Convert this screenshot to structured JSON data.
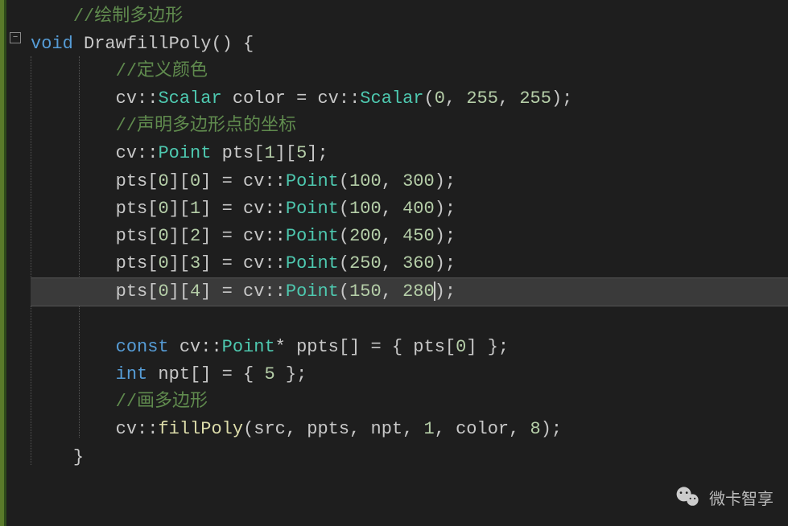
{
  "code": {
    "comment_draw": "//绘制多边形",
    "kw_void": "void",
    "func_name": " DrawfillPoly",
    "paren_open": "() {",
    "comment_color": "//定义颜色",
    "l4_p1": "cv::",
    "l4_type1": "Scalar",
    "l4_p2": " color = cv::",
    "l4_type2": "Scalar",
    "l4_p3": "(",
    "l4_n1": "0",
    "l4_p4": ", ",
    "l4_n2": "255",
    "l4_p5": ", ",
    "l4_n3": "255",
    "l4_p6": ");",
    "comment_pts": "//声明多边形点的坐标",
    "l6_p1": "cv::",
    "l6_type": "Point",
    "l6_p2": " pts[",
    "l6_n1": "1",
    "l6_p3": "][",
    "l6_n2": "5",
    "l6_p4": "];",
    "pt0_p1": "pts[",
    "pt0_n1": "0",
    "pt0_p2": "][",
    "pt0_n2": "0",
    "pt0_p3": "] = cv::",
    "pt0_type": "Point",
    "pt0_p4": "(",
    "pt0_x": "100",
    "pt0_c": ", ",
    "pt0_y": "300",
    "pt0_p5": ");",
    "pt1_p1": "pts[",
    "pt1_n1": "0",
    "pt1_p2": "][",
    "pt1_n2": "1",
    "pt1_p3": "] = cv::",
    "pt1_type": "Point",
    "pt1_p4": "(",
    "pt1_x": "100",
    "pt1_c": ", ",
    "pt1_y": "400",
    "pt1_p5": ");",
    "pt2_p1": "pts[",
    "pt2_n1": "0",
    "pt2_p2": "][",
    "pt2_n2": "2",
    "pt2_p3": "] = cv::",
    "pt2_type": "Point",
    "pt2_p4": "(",
    "pt2_x": "200",
    "pt2_c": ", ",
    "pt2_y": "450",
    "pt2_p5": ");",
    "pt3_p1": "pts[",
    "pt3_n1": "0",
    "pt3_p2": "][",
    "pt3_n2": "3",
    "pt3_p3": "] = cv::",
    "pt3_type": "Point",
    "pt3_p4": "(",
    "pt3_x": "250",
    "pt3_c": ", ",
    "pt3_y": "360",
    "pt3_p5": ");",
    "pt4_p1": "pts[",
    "pt4_n1": "0",
    "pt4_p2": "][",
    "pt4_n2": "4",
    "pt4_p3": "] = cv::",
    "pt4_type": "Point",
    "pt4_p4": "(",
    "pt4_x": "150",
    "pt4_c": ", ",
    "pt4_y": "280",
    "pt4_p5": ");",
    "l13_kw": "const",
    "l13_p1": " cv::",
    "l13_type": "Point",
    "l13_p2": "* ppts[] = { pts[",
    "l13_n": "0",
    "l13_p3": "] };",
    "l14_kw": "int",
    "l14_p1": " npt[] = { ",
    "l14_n": "5",
    "l14_p2": " };",
    "comment_fill": "//画多边形",
    "l16_p1": "cv::",
    "l16_func": "fillPoly",
    "l16_p2": "(src, ppts, npt, ",
    "l16_n1": "1",
    "l16_p3": ", color, ",
    "l16_n2": "8",
    "l16_p4": ");",
    "brace_close": "}",
    "indent1": "    ",
    "indent2": "        "
  },
  "watermark": {
    "text": "微卡智享"
  }
}
